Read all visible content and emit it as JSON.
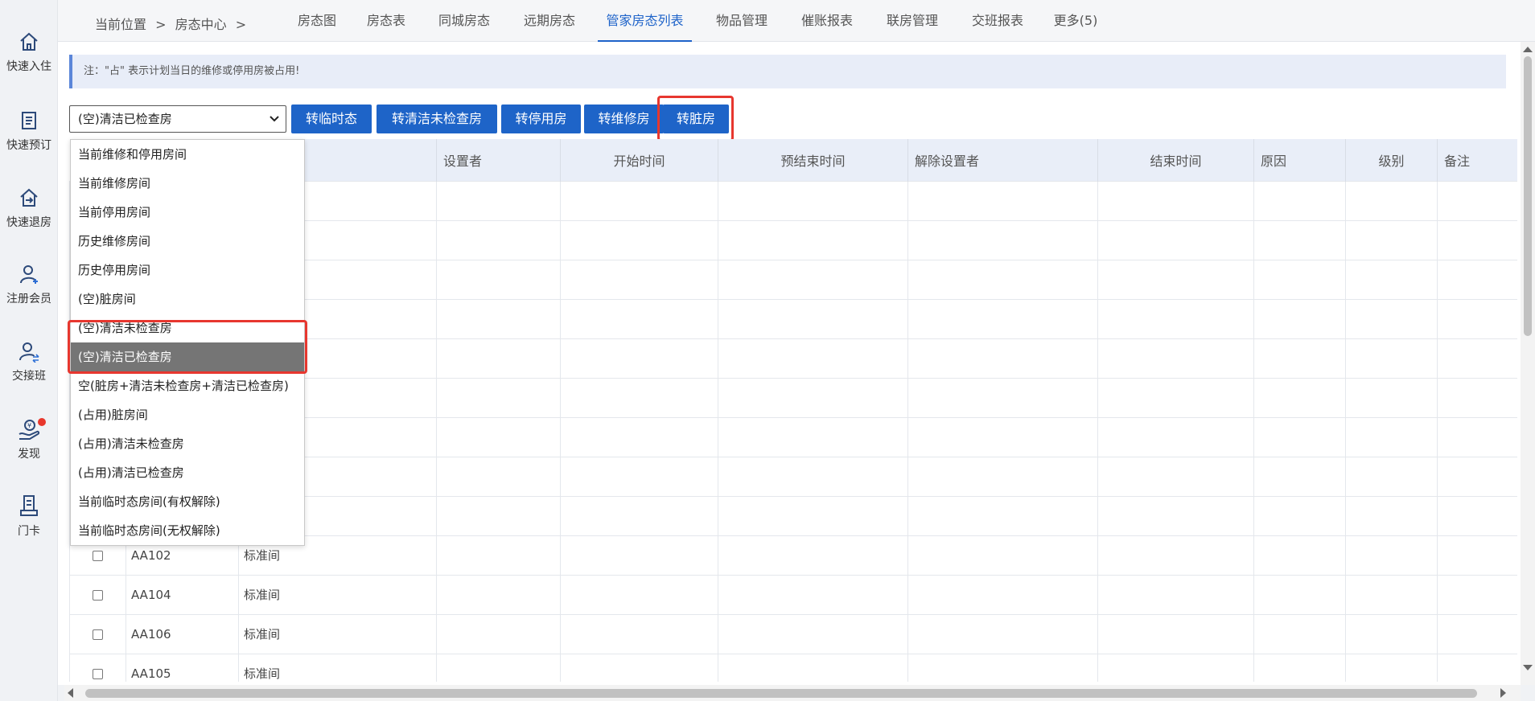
{
  "sidebar": {
    "items": [
      {
        "label": "快速入住",
        "icon": "home-icon"
      },
      {
        "label": "快速预订",
        "icon": "book-icon"
      },
      {
        "label": "快速退房",
        "icon": "checkout-icon"
      },
      {
        "label": "注册会员",
        "icon": "add-user-icon"
      },
      {
        "label": "交接班",
        "icon": "shift-handover-icon"
      },
      {
        "label": "发现",
        "icon": "discover-icon"
      },
      {
        "label": "门卡",
        "icon": "room-card-icon"
      }
    ]
  },
  "breadcrumb": {
    "current": "当前位置",
    "sep1": ">",
    "section": "房态中心",
    "sep2": ">"
  },
  "tabs": [
    {
      "label": "房态图"
    },
    {
      "label": "房态表"
    },
    {
      "label": "同城房态"
    },
    {
      "label": "远期房态"
    },
    {
      "label": "管家房态列表",
      "active": true
    },
    {
      "label": "物品管理"
    },
    {
      "label": "催账报表"
    },
    {
      "label": "联房管理"
    },
    {
      "label": "交班报表"
    },
    {
      "label": "更多(5)"
    }
  ],
  "notice": "注：\"占\" 表示计划当日的维修或停用房被占用!",
  "filter": {
    "selected": "(空)清洁已检查房"
  },
  "buttons": {
    "to_temp": "转临时态",
    "to_clean_unchecked": "转清洁未检查房",
    "to_disabled": "转停用房",
    "to_repair": "转维修房",
    "to_dirty": "转脏房"
  },
  "dropdown": {
    "options": [
      "当前维修和停用房间",
      "当前维修房间",
      "当前停用房间",
      "历史维修房间",
      "历史停用房间",
      "(空)脏房间",
      "(空)清洁未检查房",
      "(空)清洁已检查房",
      "空(脏房+清洁未检查房+清洁已检查房)",
      "(占用)脏房间",
      "(占用)清洁未检查房",
      "(占用)清洁已检查房",
      "当前临时态房间(有权解除)",
      "当前临时态房间(无权解除)"
    ],
    "selected_index": 7
  },
  "table": {
    "headers": [
      "",
      "",
      "",
      "设置者",
      "开始时间",
      "预结束时间",
      "解除设置者",
      "结束时间",
      "原因",
      "级别",
      "备注"
    ],
    "rows": [
      {
        "room": "",
        "type": ""
      },
      {
        "room": "",
        "type": ""
      },
      {
        "room": "",
        "type": ""
      },
      {
        "room": "",
        "type": ""
      },
      {
        "room": "",
        "type": ""
      },
      {
        "room": "",
        "type": ""
      },
      {
        "room": "",
        "type": ""
      },
      {
        "room": "",
        "type": ""
      },
      {
        "room": "",
        "type": ""
      },
      {
        "room": "AA102",
        "type": "标准间"
      },
      {
        "room": "AA104",
        "type": "标准间"
      },
      {
        "room": "AA106",
        "type": "标准间"
      },
      {
        "room": "AA105",
        "type": "标准间"
      }
    ]
  },
  "colors": {
    "accent": "#1e64c8",
    "highlight": "#e7372f",
    "selected_option": "#757575",
    "notification_dot": "#e8372c"
  }
}
